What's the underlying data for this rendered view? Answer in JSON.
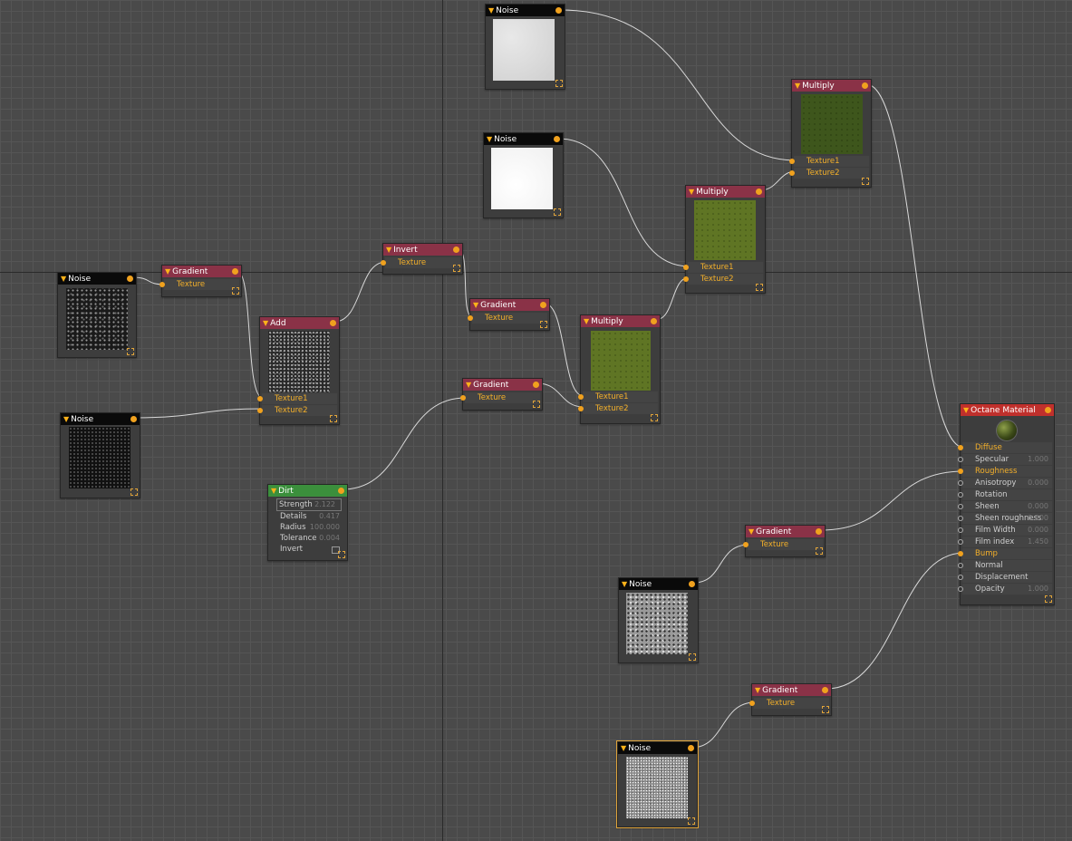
{
  "labels": {
    "noise": "Noise",
    "gradient": "Gradient",
    "invert": "Invert",
    "add": "Add",
    "multiply": "Multiply",
    "dirt": "Dirt",
    "texture": "Texture",
    "texture1": "Texture1",
    "texture2": "Texture2"
  },
  "dirt": {
    "params": [
      {
        "label": "Strength",
        "value": "2.122"
      },
      {
        "label": "Details",
        "value": "0.417"
      },
      {
        "label": "Radius",
        "value": "100.000"
      },
      {
        "label": "Tolerance",
        "value": "0.004"
      },
      {
        "label": "Invert",
        "value": ""
      }
    ]
  },
  "material": {
    "title": "Octane Material",
    "pins": [
      {
        "label": "Diffuse",
        "value": ""
      },
      {
        "label": "Specular",
        "value": "1.000"
      },
      {
        "label": "Roughness",
        "value": ""
      },
      {
        "label": "Anisotropy",
        "value": "0.000"
      },
      {
        "label": "Rotation",
        "value": ""
      },
      {
        "label": "Sheen",
        "value": "0.000"
      },
      {
        "label": "Sheen roughness",
        "value": "0.200"
      },
      {
        "label": "Film Width",
        "value": "0.000"
      },
      {
        "label": "Film index",
        "value": "1.450"
      },
      {
        "label": "Bump",
        "value": ""
      },
      {
        "label": "Normal",
        "value": ""
      },
      {
        "label": "Displacement",
        "value": ""
      },
      {
        "label": "Opacity",
        "value": "1.000"
      }
    ]
  },
  "colors": {
    "port": "#f0a11e",
    "wire": "#d8d8d8",
    "header_red": "#8a3247",
    "header_green": "#3b8f3c",
    "header_black": "#0a0a0a",
    "header_material": "#c0302c"
  }
}
